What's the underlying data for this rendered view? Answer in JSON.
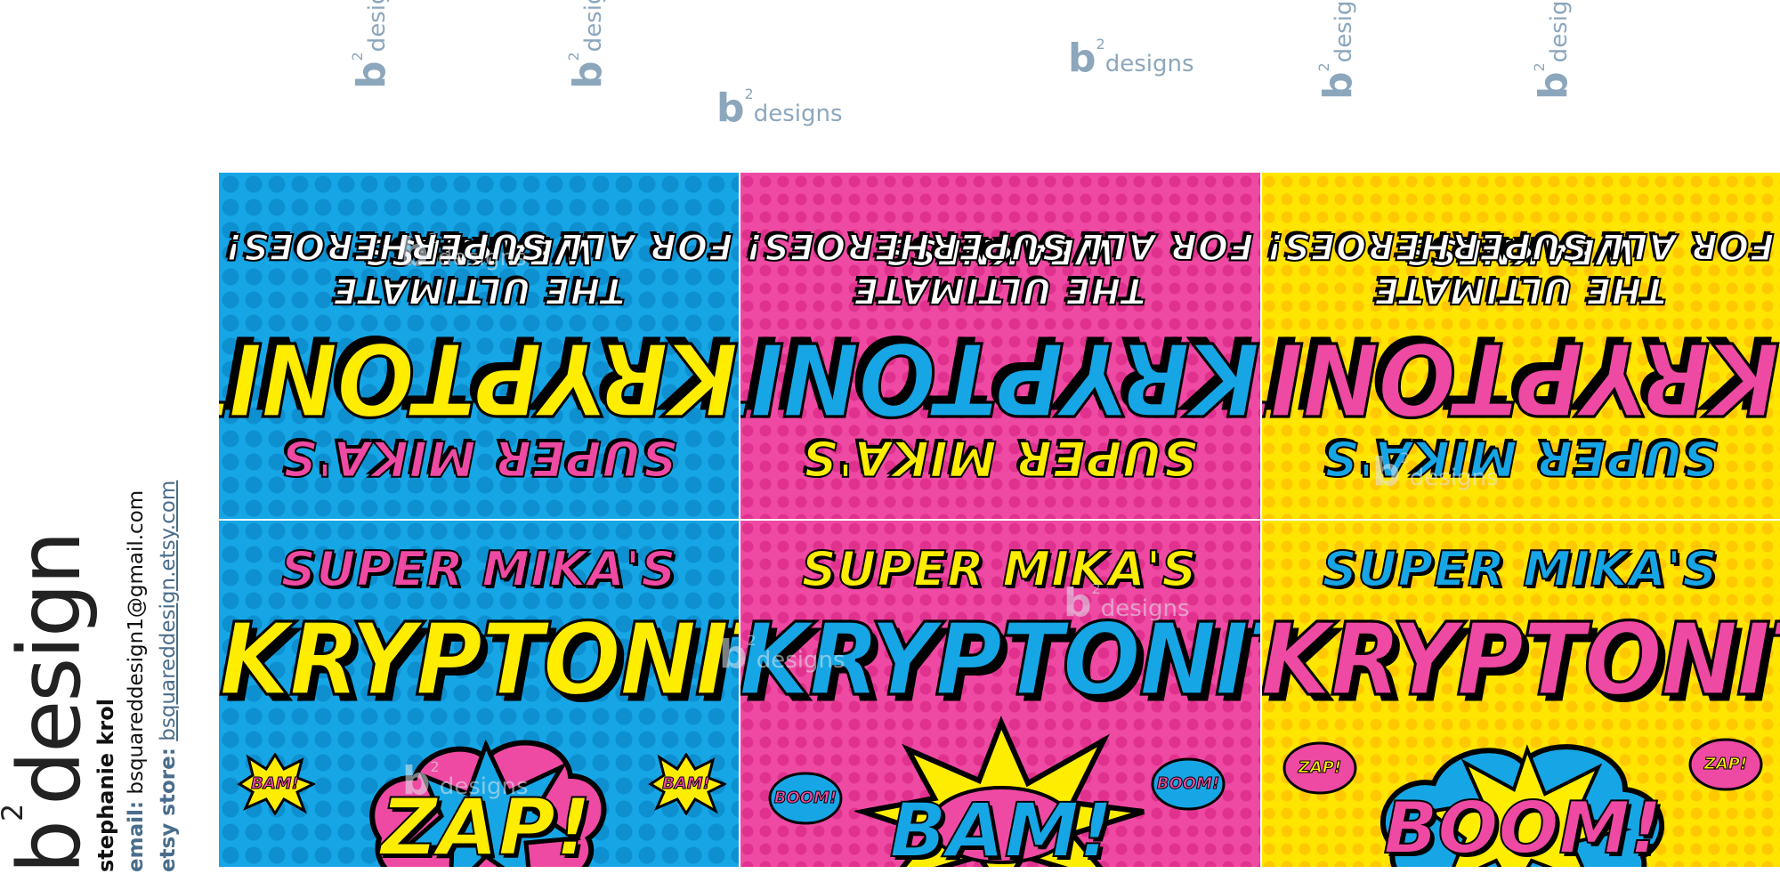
{
  "branding": {
    "logo_letter": "b",
    "logo_sup": "2",
    "logo_word": "design",
    "name": "stephanie krol",
    "email_label": "email:",
    "email": "bsquareddesign1@gmail.com",
    "store_label": "etsy store:",
    "store_url": "bsquareddesign.etsy.com"
  },
  "watermark": {
    "letter": "b",
    "sup": "2",
    "word": "designs"
  },
  "labels": [
    {
      "theme": "blue",
      "small_name": "SUPER MIKA'S",
      "title": "KRYPTONITE",
      "tagline_1": "THE ULTIMATE WEAKNESS",
      "tagline_2": "FOR ALL SUPERHEROES!",
      "burst": "ZAP!",
      "mini_left": "BAM!",
      "mini_right": "BAM!"
    },
    {
      "theme": "pink",
      "small_name": "SUPER MIKA'S",
      "title": "KRYPTONITE",
      "tagline_1": "THE ULTIMATE WEAKNESS",
      "tagline_2": "FOR ALL SUPERHEROES!",
      "burst": "BAM!",
      "mini_left": "BOOM!",
      "mini_right": "BOOM!"
    },
    {
      "theme": "yellow",
      "small_name": "SUPER MIKA'S",
      "title": "KRYPTONITE",
      "tagline_1": "THE ULTIMATE WEAKNESS",
      "tagline_2": "FOR ALL SUPERHEROES!",
      "burst": "BOOM!",
      "mini_left": "ZAP!",
      "mini_right": "ZAP!"
    }
  ],
  "colors": {
    "blue": "#16a6e6",
    "pink": "#ef4aa3",
    "yellow": "#ffe500",
    "watermark": "#2f5f86",
    "brand_link": "#4a6d8c"
  }
}
